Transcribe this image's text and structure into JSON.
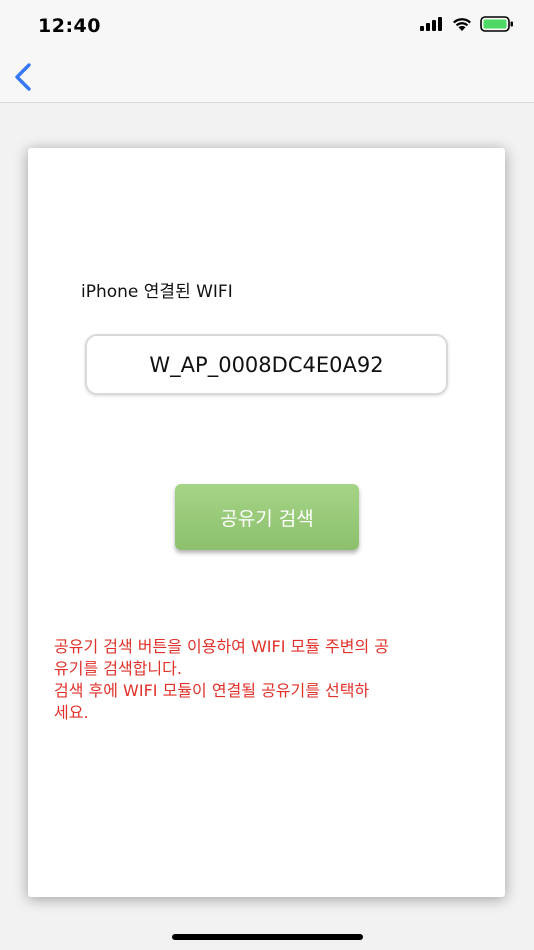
{
  "status": {
    "time": "12:40"
  },
  "nav": {
    "back_icon": "chevron-left-icon"
  },
  "main": {
    "wifi_label": "iPhone  연결된 WIFI",
    "ssid_value": "W_AP_0008DC4E0A92",
    "search_button_label": "공유기 검색",
    "message_lines": [
      "공유기 검색 버튼을 이용하여 WIFI 모듈 주변의 공",
      "유기를 검색합니다.",
      "검색 후에 WIFI 모듈이 연결될 공유기를 선택하",
      "세요."
    ]
  },
  "colors": {
    "accent": "#3478f6",
    "button_top": "#a5d486",
    "button_bottom": "#8cc06d",
    "message": "#e0322b",
    "battery": "#4cd964"
  }
}
